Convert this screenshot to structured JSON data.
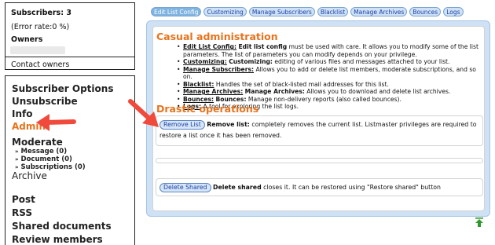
{
  "sidebar": {
    "subscribers_label": "Subscribers: 3",
    "error_rate": "(Error rate:0 %)",
    "owners_label": "Owners",
    "contact_owners": "Contact owners",
    "menu": {
      "subscriber_options": "Subscriber Options",
      "unsubscribe": "Unsubscribe",
      "info": "Info",
      "admin": "Admin",
      "moderate": "Moderate",
      "moderate_items": [
        "Message (0)",
        "Document (0)",
        "Subscriptions (0)"
      ],
      "archive": "Archive",
      "post": "Post",
      "rss": "RSS",
      "shared_documents": "Shared documents",
      "review_members": "Review members"
    }
  },
  "tabs": [
    "Edit List Config",
    "Customizing",
    "Manage Subscribers",
    "Blacklist",
    "Manage Archives",
    "Bounces",
    "Logs"
  ],
  "admin": {
    "casual_title": "Casual administration",
    "casual_items": [
      {
        "name": "Edit List Config:",
        "bold": "Edit list config",
        "text": " must be used with care. It allows you to modify some of the list parameters. The list of parameters you can modify depends on your privilege."
      },
      {
        "name": "Customizing:",
        "bold": "Customizing:",
        "text": " editing of various files and messages attached to your list."
      },
      {
        "name": "Manage Subscribers:",
        "bold": "",
        "text": "Allows you to add or delete list members, moderate subscriptions, and so on."
      },
      {
        "name": "Blacklist:",
        "bold": "",
        "text": "Handles the set of black-listed mail addresses for this list."
      },
      {
        "name": "Manage Archives:",
        "bold": "Manage Archives:",
        "text": " Allows you to download and delete list archives."
      },
      {
        "name": "Bounces:",
        "bold": "Bounces:",
        "text": " Manage non-delivery reports (also called bounces)."
      },
      {
        "name": "Logs:",
        "bold": "",
        "text": "A tool for exploring the list logs."
      }
    ],
    "drastic_title": "Drastic operations",
    "remove_button": "Remove List",
    "remove_bold": "Remove list:",
    "remove_text": " completely removes the current list. Listmaster privileges are required to restore a list once it has been removed.",
    "delete_button": "Delete Shared",
    "delete_bold": "Delete shared",
    "delete_text": " closes it. It can be restored using \"Restore shared\" button"
  },
  "colors": {
    "accent_orange": "#e8731d",
    "tab_blue": "#cfe2f5",
    "link_blue": "#1c3fa8",
    "annotation_red": "#ef4a3b",
    "top_arrow_green": "#2e9a2e"
  },
  "icons": {
    "back_to_top": "green-up-arrow-icon",
    "annotation": "red-arrow-icon"
  }
}
